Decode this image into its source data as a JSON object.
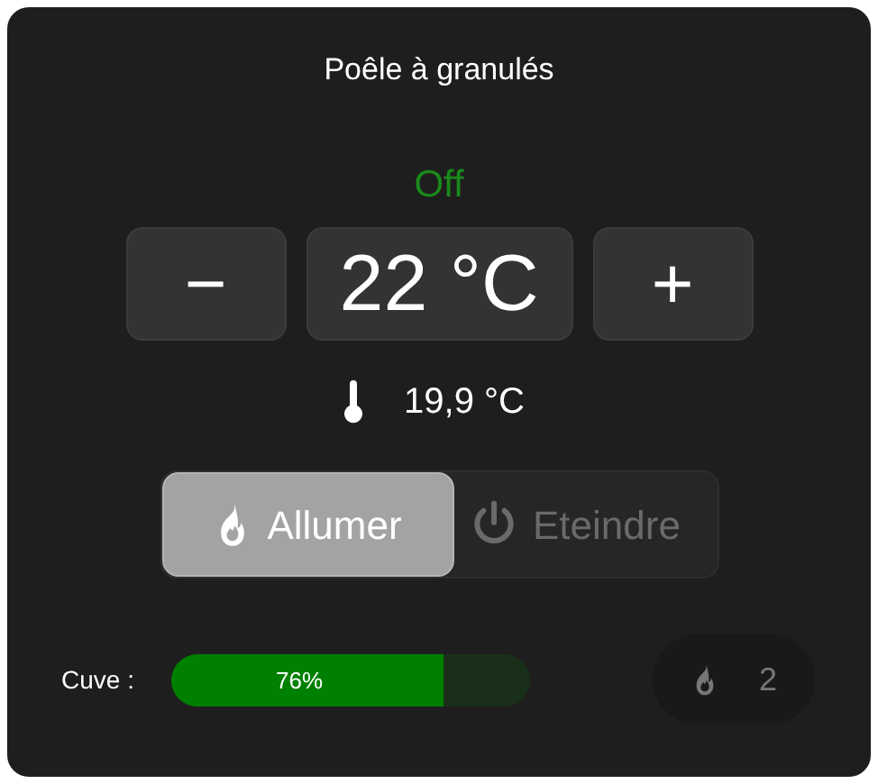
{
  "title": "Poêle à granulés",
  "status": "Off",
  "setpoint": {
    "minus": "−",
    "value": "22 °C",
    "plus": "+"
  },
  "current_temperature": "19,9 °C",
  "modes": [
    {
      "kind": "flame",
      "label": "Allumer",
      "selected": true
    },
    {
      "kind": "power",
      "label": "Eteindre",
      "selected": false
    }
  ],
  "tank": {
    "label": "Cuve :",
    "level": 0.76,
    "reading": "76%"
  },
  "power_level": "2"
}
